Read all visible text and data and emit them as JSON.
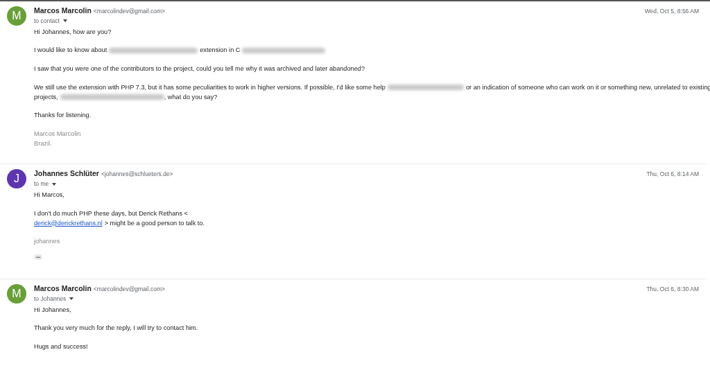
{
  "messages": [
    {
      "avatar": {
        "letter": "M",
        "color": "#689f38"
      },
      "sender": "Marcos Marcolin",
      "email": "<marcolindev@gmail.com>",
      "recipient": "to contact",
      "date": "Wed, Oct 5, 8:56 AM",
      "body": [
        [
          [
            {
              "kind": "text",
              "text": "Hi Johannes, how are you?"
            }
          ]
        ],
        [
          [
            {
              "kind": "text",
              "text": "I would like to know about"
            },
            {
              "kind": "redacted"
            },
            {
              "kind": "text",
              "text": "extension in C"
            },
            {
              "kind": "redacted"
            }
          ]
        ],
        [
          [
            {
              "kind": "text",
              "text": "I saw that you were one of the contributors to the project, could you tell me why it was archived and later abandoned?"
            }
          ]
        ],
        [
          [
            {
              "kind": "text",
              "text": "We still use the extension with PHP 7.3, but it has some peculiarities to work in higher versions. If possible, I'd like some help"
            },
            {
              "kind": "redacted"
            },
            {
              "kind": "text",
              "text": "or an indication of someone who can work on it or something new, unrelated to existing"
            }
          ],
          [
            {
              "kind": "text",
              "text": "projects,"
            },
            {
              "kind": "redacted"
            },
            {
              "kind": "text",
              "text": ", what do you say?"
            }
          ]
        ],
        [
          [
            {
              "kind": "text",
              "text": "Thanks for listening."
            }
          ]
        ]
      ],
      "signature": [
        "Marcos Marcolin",
        "Brazil."
      ]
    },
    {
      "avatar": {
        "letter": "J",
        "color": "#5e35b1"
      },
      "sender": "Johannes Schlüter",
      "email": "<johannes@schlueters.de>",
      "recipient": "to me",
      "date": "Thu, Oct 6, 8:14 AM",
      "body": [
        [
          [
            {
              "kind": "text",
              "text": "Hi Marcos,"
            }
          ]
        ],
        [
          [
            {
              "kind": "text",
              "text": "I don't do much PHP these days, but Derick Rethans <"
            }
          ],
          [
            {
              "kind": "link",
              "text": "derick@derickrethans.nl"
            },
            {
              "kind": "text",
              "text": "> might be a good person to talk to."
            }
          ]
        ]
      ],
      "signature": [
        "johannes"
      ],
      "trimmed_content_button": "•••"
    },
    {
      "avatar": {
        "letter": "M",
        "color": "#689f38"
      },
      "sender": "Marcos Marcolin",
      "email": "<marcolindev@gmail.com>",
      "recipient": "to Johannes",
      "date": "Thu, Oct 6, 8:30 AM",
      "body": [
        [
          [
            {
              "kind": "text",
              "text": "Hi Johannes,"
            }
          ]
        ],
        [
          [
            {
              "kind": "text",
              "text": "Thank you very much for the reply, I will try to contact him."
            }
          ]
        ],
        [
          [
            {
              "kind": "text",
              "text": "Hugs and success!"
            }
          ]
        ]
      ]
    }
  ]
}
